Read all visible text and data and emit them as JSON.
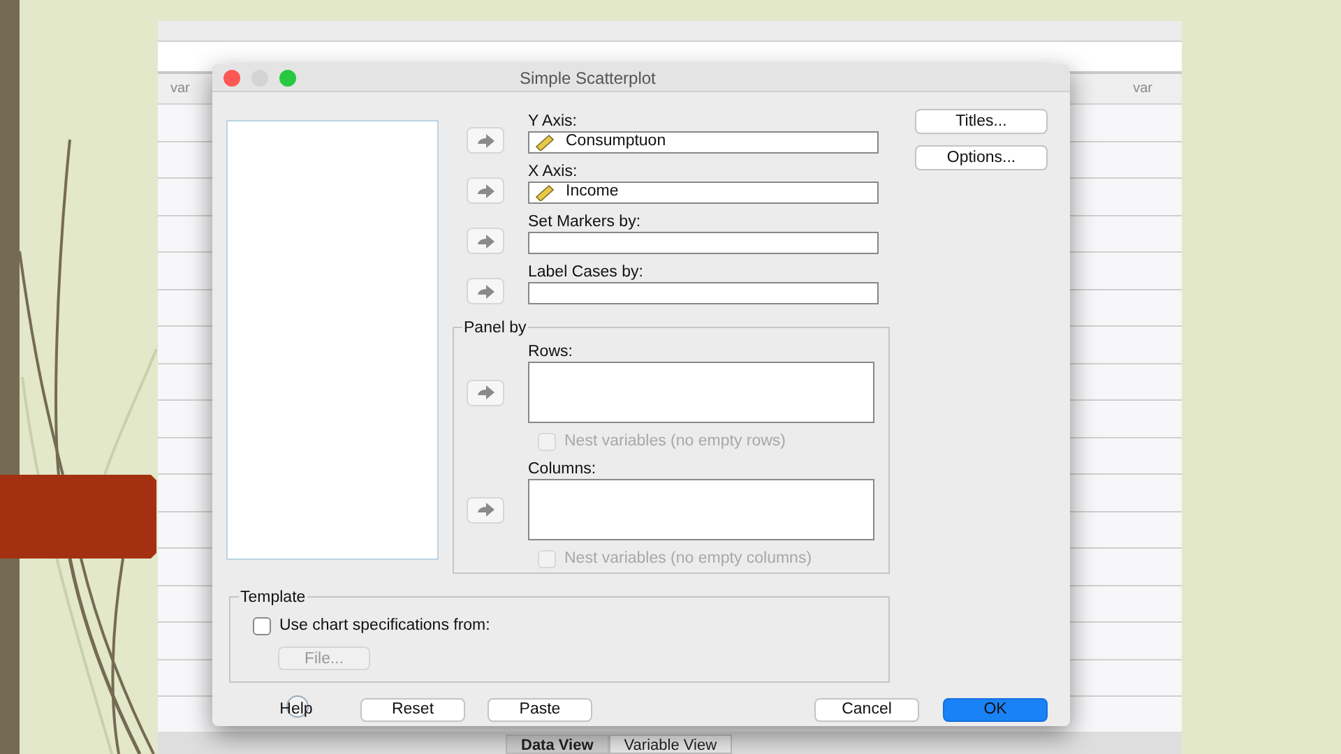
{
  "data_editor": {
    "column_headers": [
      "var",
      "var"
    ],
    "view_tabs": [
      {
        "label": "Data View",
        "selected": true
      },
      {
        "label": "Variable View",
        "selected": false
      }
    ]
  },
  "window": {
    "title": "Simple Scatterplot"
  },
  "targets": [
    {
      "label": "Y Axis:",
      "value": "Consumptuon"
    },
    {
      "label": "X Axis:",
      "value": "Income"
    },
    {
      "label": "Set Markers by:"
    },
    {
      "label": "Label Cases by:"
    }
  ],
  "side_buttons": [
    "Titles...",
    "Options..."
  ],
  "panel_by": {
    "title": "Panel by",
    "sections": [
      {
        "label": "Rows:",
        "nest": {
          "label": "Nest variables (no empty rows)",
          "checked": false,
          "disabled": true
        }
      },
      {
        "label": "Columns:",
        "nest": {
          "label": "Nest variables (no empty columns)",
          "checked": false,
          "disabled": true
        }
      }
    ]
  },
  "template": {
    "title": "Template",
    "option": {
      "label": "Use chart specifications from:",
      "checked": false
    },
    "file_button": {
      "label": "File...",
      "disabled": true
    }
  },
  "left_buttons": [
    {
      "label": "Help",
      "kind": "help"
    },
    {
      "label": "Reset",
      "kind": "normal"
    },
    {
      "label": "Paste",
      "kind": "normal"
    }
  ],
  "right_buttons": [
    {
      "label": "Cancel",
      "kind": "normal"
    },
    {
      "label": "OK",
      "kind": "default"
    }
  ]
}
